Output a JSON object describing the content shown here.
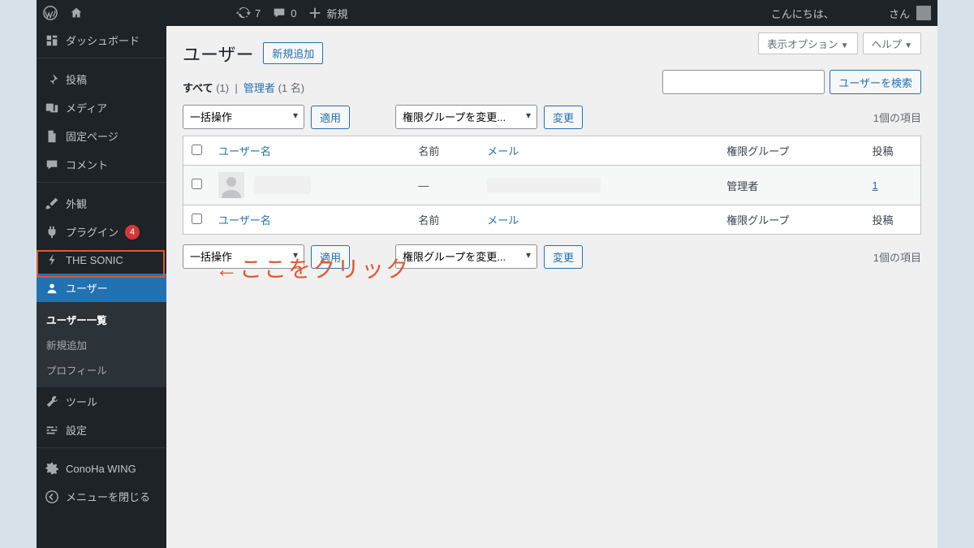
{
  "adminbar": {
    "updates_count": "7",
    "comments_count": "0",
    "new_label": "新規",
    "greeting": "こんにちは、",
    "greeting_suffix": "さん"
  },
  "sidebar": {
    "items": [
      {
        "id": "dashboard",
        "label": "ダッシュボード"
      },
      {
        "id": "posts",
        "label": "投稿"
      },
      {
        "id": "media",
        "label": "メディア"
      },
      {
        "id": "pages",
        "label": "固定ページ"
      },
      {
        "id": "comments",
        "label": "コメント"
      },
      {
        "id": "appearance",
        "label": "外観"
      },
      {
        "id": "plugins",
        "label": "プラグイン",
        "badge": "4"
      },
      {
        "id": "thesonic",
        "label": "THE SONIC"
      },
      {
        "id": "users",
        "label": "ユーザー"
      },
      {
        "id": "tools",
        "label": "ツール"
      },
      {
        "id": "settings",
        "label": "設定"
      },
      {
        "id": "conoha",
        "label": "ConoHa WING"
      },
      {
        "id": "collapse",
        "label": "メニューを閉じる"
      }
    ],
    "submenu_users": [
      {
        "label": "ユーザー一覧",
        "current": true
      },
      {
        "label": "新規追加"
      },
      {
        "label": "プロフィール"
      }
    ]
  },
  "screen_options": "表示オプション",
  "help_label": "ヘルプ",
  "page_title": "ユーザー",
  "add_new": "新規追加",
  "filters": {
    "all_label": "すべて",
    "all_count": "(1)",
    "admin_label": "管理者",
    "admin_count": "(1 名)"
  },
  "search_button": "ユーザーを検索",
  "bulk_select": "一括操作",
  "apply": "適用",
  "role_select": "権限グループを変更...",
  "change": "変更",
  "items_count": "1個の項目",
  "columns": {
    "username": "ユーザー名",
    "name": "名前",
    "email": "メール",
    "role": "権限グループ",
    "posts": "投稿"
  },
  "row": {
    "name_placeholder": "—",
    "role": "管理者",
    "posts": "1"
  },
  "annotation": "←ここをクリック"
}
